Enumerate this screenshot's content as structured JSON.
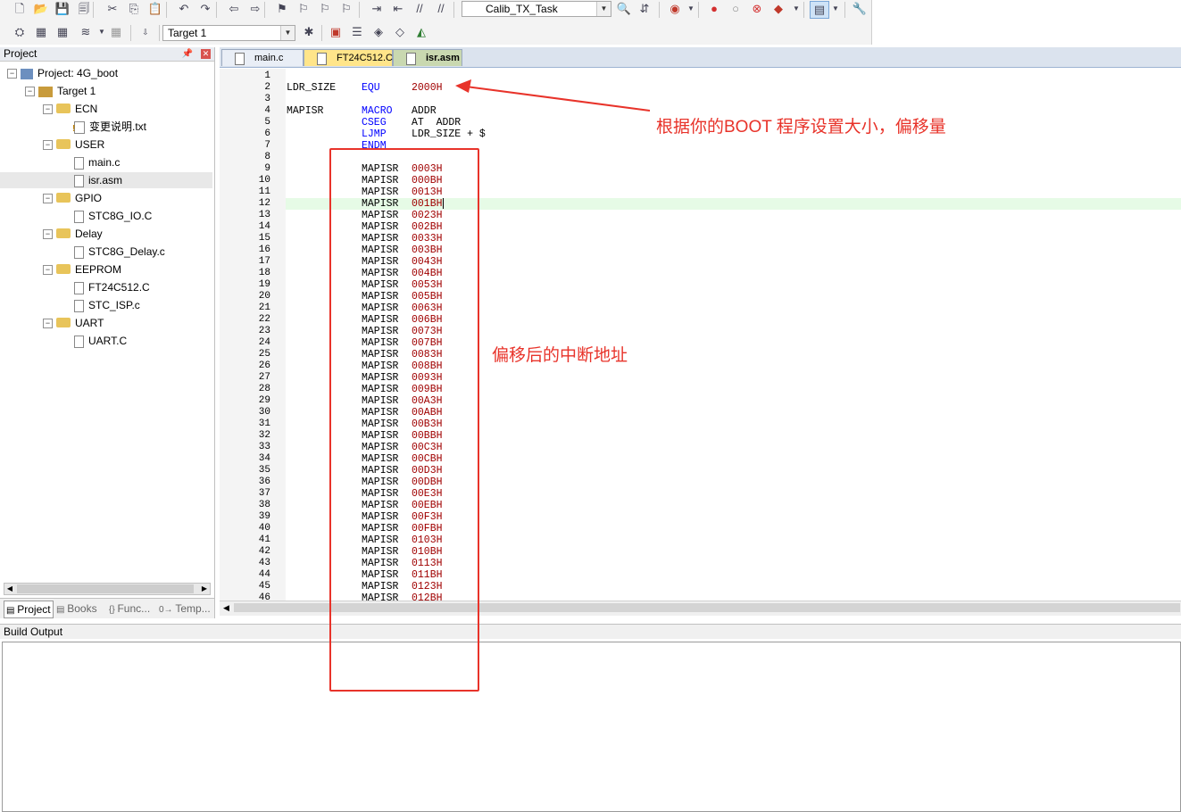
{
  "toolbar": {
    "row1_buttons": [
      {
        "name": "new-file",
        "glyph": "🗋"
      },
      {
        "name": "open-file",
        "glyph": "📂"
      },
      {
        "name": "save",
        "glyph": "💾"
      },
      {
        "name": "save-all",
        "glyph": "🗐"
      },
      {
        "name": "cut",
        "glyph": "✂"
      },
      {
        "name": "copy",
        "glyph": "⎘"
      },
      {
        "name": "paste",
        "glyph": "📋"
      },
      {
        "name": "undo",
        "glyph": "↶"
      },
      {
        "name": "redo",
        "glyph": "↷"
      },
      {
        "name": "navigate-back",
        "glyph": "⇦"
      },
      {
        "name": "navigate-forward",
        "glyph": "⇨"
      },
      {
        "name": "bookmark",
        "glyph": "⚑"
      },
      {
        "name": "bookmark-prev",
        "glyph": "⚐"
      },
      {
        "name": "bookmark-next",
        "glyph": "⚐"
      },
      {
        "name": "bookmark-clear",
        "glyph": "⚐"
      },
      {
        "name": "indent",
        "glyph": "⇥"
      },
      {
        "name": "unindent",
        "glyph": "⇤"
      },
      {
        "name": "comment",
        "glyph": "//"
      },
      {
        "name": "uncomment",
        "glyph": "//"
      }
    ],
    "function_combo": "Calib_TX_Task",
    "target_combo": "Target 1"
  },
  "project_pane": {
    "title": "Project",
    "tree": [
      {
        "label": "Project: 4G_boot",
        "icon": "project",
        "level": 0,
        "expander": "−"
      },
      {
        "label": "Target 1",
        "icon": "target",
        "level": 1,
        "expander": "−"
      },
      {
        "label": "ECN",
        "icon": "folder",
        "level": 2,
        "expander": "−"
      },
      {
        "label": "变更说明.txt",
        "icon": "warn-file",
        "level": 3
      },
      {
        "label": "USER",
        "icon": "folder",
        "level": 2,
        "expander": "−"
      },
      {
        "label": "main.c",
        "icon": "file",
        "level": 3
      },
      {
        "label": "isr.asm",
        "icon": "file",
        "level": 3,
        "selected": true
      },
      {
        "label": "GPIO",
        "icon": "folder",
        "level": 2,
        "expander": "−"
      },
      {
        "label": "STC8G_IO.C",
        "icon": "file",
        "level": 3
      },
      {
        "label": "Delay",
        "icon": "folder",
        "level": 2,
        "expander": "−"
      },
      {
        "label": "STC8G_Delay.c",
        "icon": "file",
        "level": 3
      },
      {
        "label": "EEPROM",
        "icon": "folder",
        "level": 2,
        "expander": "−"
      },
      {
        "label": "FT24C512.C",
        "icon": "file",
        "level": 3
      },
      {
        "label": "STC_ISP.c",
        "icon": "file",
        "level": 3
      },
      {
        "label": "UART",
        "icon": "folder",
        "level": 2,
        "expander": "−"
      },
      {
        "label": "UART.C",
        "icon": "file",
        "level": 3
      }
    ],
    "tabs": [
      {
        "label": "Project",
        "icon": "project-tab-icon",
        "active": true
      },
      {
        "label": "Books",
        "icon": "books-icon"
      },
      {
        "label": "Func...",
        "icon": "functions-icon",
        "prefix": "{}"
      },
      {
        "label": "Temp...",
        "icon": "templates-icon",
        "prefix": "0→"
      }
    ]
  },
  "editor": {
    "tabs": [
      {
        "label": "main.c"
      },
      {
        "label": "FT24C512.C"
      },
      {
        "label": "isr.asm",
        "active": true
      }
    ],
    "highlighted_line": 12,
    "lines": [
      {
        "n": "1",
        "a": "",
        "b": "",
        "c": ""
      },
      {
        "n": "2",
        "a": "LDR_SIZE",
        "b": "EQU",
        "c": "2000H",
        "bcls": "kw",
        "ccls": "num"
      },
      {
        "n": "3",
        "a": "",
        "b": "",
        "c": ""
      },
      {
        "n": "4",
        "a": "MAPISR",
        "b": "MACRO",
        "c": "ADDR",
        "bcls": "kw"
      },
      {
        "n": "5",
        "a": "",
        "b": "CSEG",
        "c": "AT  ADDR",
        "bcls": "kw",
        "cprefix": "AT"
      },
      {
        "n": "6",
        "a": "",
        "b": "LJMP",
        "c": "LDR_SIZE + $",
        "bcls": "kw"
      },
      {
        "n": "7",
        "a": "",
        "b": "ENDM",
        "c": "",
        "bcls": "kw"
      },
      {
        "n": "8",
        "a": "",
        "b": "",
        "c": ""
      },
      {
        "n": "9",
        "a": "",
        "b": "MAPISR",
        "c": "0003H",
        "ccls": "num"
      },
      {
        "n": "10",
        "a": "",
        "b": "MAPISR",
        "c": "000BH",
        "ccls": "num"
      },
      {
        "n": "11",
        "a": "",
        "b": "MAPISR",
        "c": "0013H",
        "ccls": "num"
      },
      {
        "n": "12",
        "a": "",
        "b": "MAPISR",
        "c": "001BH",
        "ccls": "num"
      },
      {
        "n": "13",
        "a": "",
        "b": "MAPISR",
        "c": "0023H",
        "ccls": "num"
      },
      {
        "n": "14",
        "a": "",
        "b": "MAPISR",
        "c": "002BH",
        "ccls": "num"
      },
      {
        "n": "15",
        "a": "",
        "b": "MAPISR",
        "c": "0033H",
        "ccls": "num"
      },
      {
        "n": "16",
        "a": "",
        "b": "MAPISR",
        "c": "003BH",
        "ccls": "num"
      },
      {
        "n": "17",
        "a": "",
        "b": "MAPISR",
        "c": "0043H",
        "ccls": "num"
      },
      {
        "n": "18",
        "a": "",
        "b": "MAPISR",
        "c": "004BH",
        "ccls": "num"
      },
      {
        "n": "19",
        "a": "",
        "b": "MAPISR",
        "c": "0053H",
        "ccls": "num"
      },
      {
        "n": "20",
        "a": "",
        "b": "MAPISR",
        "c": "005BH",
        "ccls": "num"
      },
      {
        "n": "21",
        "a": "",
        "b": "MAPISR",
        "c": "0063H",
        "ccls": "num"
      },
      {
        "n": "22",
        "a": "",
        "b": "MAPISR",
        "c": "006BH",
        "ccls": "num"
      },
      {
        "n": "23",
        "a": "",
        "b": "MAPISR",
        "c": "0073H",
        "ccls": "num"
      },
      {
        "n": "24",
        "a": "",
        "b": "MAPISR",
        "c": "007BH",
        "ccls": "num"
      },
      {
        "n": "25",
        "a": "",
        "b": "MAPISR",
        "c": "0083H",
        "ccls": "num"
      },
      {
        "n": "26",
        "a": "",
        "b": "MAPISR",
        "c": "008BH",
        "ccls": "num"
      },
      {
        "n": "27",
        "a": "",
        "b": "MAPISR",
        "c": "0093H",
        "ccls": "num"
      },
      {
        "n": "28",
        "a": "",
        "b": "MAPISR",
        "c": "009BH",
        "ccls": "num"
      },
      {
        "n": "29",
        "a": "",
        "b": "MAPISR",
        "c": "00A3H",
        "ccls": "num"
      },
      {
        "n": "30",
        "a": "",
        "b": "MAPISR",
        "c": "00ABH",
        "ccls": "num"
      },
      {
        "n": "31",
        "a": "",
        "b": "MAPISR",
        "c": "00B3H",
        "ccls": "num"
      },
      {
        "n": "32",
        "a": "",
        "b": "MAPISR",
        "c": "00BBH",
        "ccls": "num"
      },
      {
        "n": "33",
        "a": "",
        "b": "MAPISR",
        "c": "00C3H",
        "ccls": "num"
      },
      {
        "n": "34",
        "a": "",
        "b": "MAPISR",
        "c": "00CBH",
        "ccls": "num"
      },
      {
        "n": "35",
        "a": "",
        "b": "MAPISR",
        "c": "00D3H",
        "ccls": "num"
      },
      {
        "n": "36",
        "a": "",
        "b": "MAPISR",
        "c": "00DBH",
        "ccls": "num"
      },
      {
        "n": "37",
        "a": "",
        "b": "MAPISR",
        "c": "00E3H",
        "ccls": "num"
      },
      {
        "n": "38",
        "a": "",
        "b": "MAPISR",
        "c": "00EBH",
        "ccls": "num"
      },
      {
        "n": "39",
        "a": "",
        "b": "MAPISR",
        "c": "00F3H",
        "ccls": "num"
      },
      {
        "n": "40",
        "a": "",
        "b": "MAPISR",
        "c": "00FBH",
        "ccls": "num"
      },
      {
        "n": "41",
        "a": "",
        "b": "MAPISR",
        "c": "0103H",
        "ccls": "num"
      },
      {
        "n": "42",
        "a": "",
        "b": "MAPISR",
        "c": "010BH",
        "ccls": "num"
      },
      {
        "n": "43",
        "a": "",
        "b": "MAPISR",
        "c": "0113H",
        "ccls": "num"
      },
      {
        "n": "44",
        "a": "",
        "b": "MAPISR",
        "c": "011BH",
        "ccls": "num"
      },
      {
        "n": "45",
        "a": "",
        "b": "MAPISR",
        "c": "0123H",
        "ccls": "num"
      },
      {
        "n": "46",
        "a": "",
        "b": "MAPISR",
        "c": "012BH",
        "ccls": "num"
      }
    ]
  },
  "build_output": {
    "title": "Build Output"
  },
  "annotations": {
    "boot_note": "根据你的BOOT 程序设置大小，偏移量",
    "offset_note": "偏移后的中断地址",
    "color": "#e8332a"
  }
}
